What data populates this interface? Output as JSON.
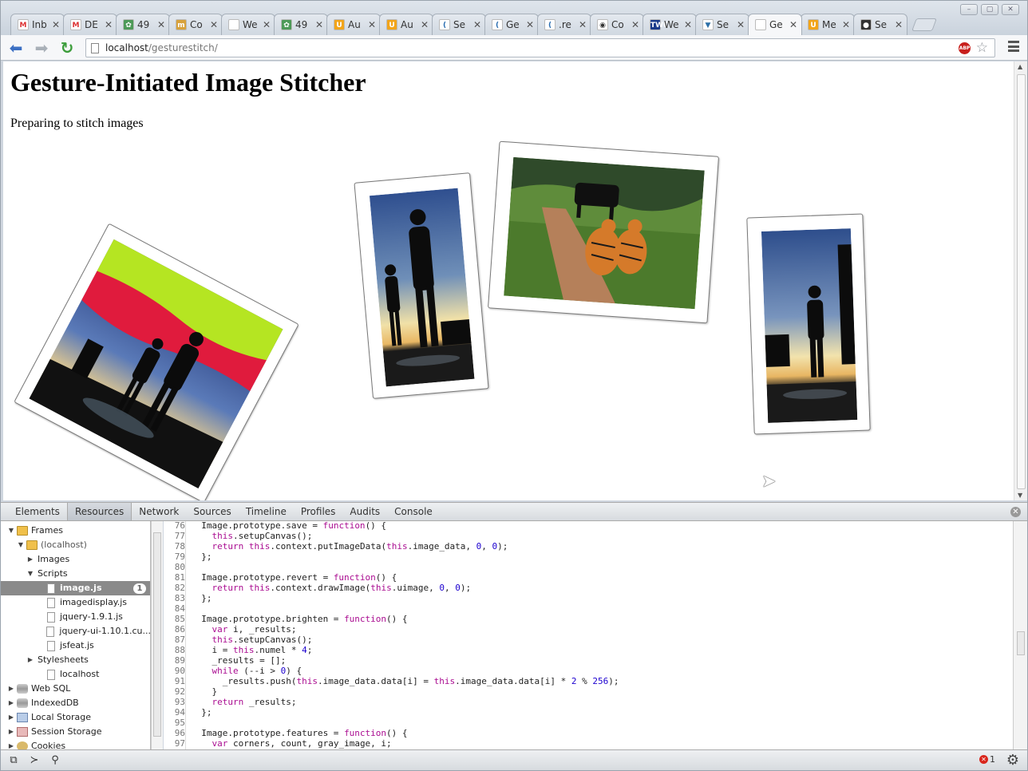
{
  "browser": {
    "tabs": [
      {
        "label": "Inb",
        "fav_color": "#fff",
        "fav_text": "M",
        "fav_fg": "#d33"
      },
      {
        "label": "DE",
        "fav_color": "#fff",
        "fav_text": "M",
        "fav_fg": "#d33"
      },
      {
        "label": "49",
        "fav_color": "#4d9a58",
        "fav_text": "✿",
        "fav_fg": "#fff"
      },
      {
        "label": "Co",
        "fav_color": "#d8a23b",
        "fav_text": "m",
        "fav_fg": "#fff"
      },
      {
        "label": "We",
        "fav_color": "#ffffff",
        "fav_text": "",
        "fav_fg": "#999"
      },
      {
        "label": "49",
        "fav_color": "#4d9a58",
        "fav_text": "✿",
        "fav_fg": "#fff"
      },
      {
        "label": "Au",
        "fav_color": "#f2a51a",
        "fav_text": "U",
        "fav_fg": "#fff"
      },
      {
        "label": "Au",
        "fav_color": "#f2a51a",
        "fav_text": "U",
        "fav_fg": "#fff"
      },
      {
        "label": "Se",
        "fav_color": "#ffffff",
        "fav_text": "(",
        "fav_fg": "#2a6db0"
      },
      {
        "label": "Ge",
        "fav_color": "#ffffff",
        "fav_text": "(",
        "fav_fg": "#2a6db0"
      },
      {
        "label": ".re",
        "fav_color": "#ffffff",
        "fav_text": "(",
        "fav_fg": "#2a6db0"
      },
      {
        "label": "Co",
        "fav_color": "#ffffff",
        "fav_text": "◉",
        "fav_fg": "#333"
      },
      {
        "label": "We",
        "fav_color": "#1a3b8a",
        "fav_text": "TWC",
        "fav_fg": "#fff"
      },
      {
        "label": "Se",
        "fav_color": "#ffffff",
        "fav_text": "▼",
        "fav_fg": "#2b6fa8"
      },
      {
        "label": "Ge",
        "fav_color": "#ffffff",
        "fav_text": "",
        "fav_fg": "#999",
        "active": true
      },
      {
        "label": "Me",
        "fav_color": "#f2a51a",
        "fav_text": "U",
        "fav_fg": "#fff"
      },
      {
        "label": "Se",
        "fav_color": "#333333",
        "fav_text": "●",
        "fav_fg": "#fff"
      }
    ],
    "url_host": "localhost",
    "url_path": "/gesturestitch/",
    "abp_label": "ABP"
  },
  "page": {
    "title": "Gesture-Initiated Image Stitcher",
    "status": "Preparing to stitch images"
  },
  "devtools": {
    "tabs": [
      "Elements",
      "Resources",
      "Network",
      "Sources",
      "Timeline",
      "Profiles",
      "Audits",
      "Console"
    ],
    "active_tab": "Resources",
    "tree": [
      {
        "label": "Frames",
        "indent": 0,
        "tri": "▼",
        "icon": "folder"
      },
      {
        "label": "(localhost)",
        "indent": 1,
        "tri": "▼",
        "icon": "folder",
        "muted": true
      },
      {
        "label": "Images",
        "indent": 2,
        "tri": "▶",
        "icon": "none"
      },
      {
        "label": "Scripts",
        "indent": 2,
        "tri": "▼",
        "icon": "none"
      },
      {
        "label": "image.js",
        "indent": 3,
        "tri": "",
        "icon": "file",
        "selected": true,
        "badge": "1"
      },
      {
        "label": "imagedisplay.js",
        "indent": 3,
        "tri": "",
        "icon": "file"
      },
      {
        "label": "jquery-1.9.1.js",
        "indent": 3,
        "tri": "",
        "icon": "file"
      },
      {
        "label": "jquery-ui-1.10.1.cu...",
        "indent": 3,
        "tri": "",
        "icon": "file"
      },
      {
        "label": "jsfeat.js",
        "indent": 3,
        "tri": "",
        "icon": "file"
      },
      {
        "label": "Stylesheets",
        "indent": 2,
        "tri": "▶",
        "icon": "none"
      },
      {
        "label": "localhost",
        "indent": 3,
        "tri": "",
        "icon": "file"
      },
      {
        "label": "Web SQL",
        "indent": 0,
        "tri": "▶",
        "icon": "db"
      },
      {
        "label": "IndexedDB",
        "indent": 0,
        "tri": "▶",
        "icon": "db"
      },
      {
        "label": "Local Storage",
        "indent": 0,
        "tri": "▶",
        "icon": "grid"
      },
      {
        "label": "Session Storage",
        "indent": 0,
        "tri": "▶",
        "icon": "gridred"
      },
      {
        "label": "Cookies",
        "indent": 0,
        "tri": "▶",
        "icon": "cookie"
      }
    ],
    "code": [
      {
        "n": "76",
        "t": "  Image.prototype.save = function() {"
      },
      {
        "n": "77",
        "t": "    this.setupCanvas();"
      },
      {
        "n": "78",
        "t": "    return this.context.putImageData(this.image_data, 0, 0);"
      },
      {
        "n": "79",
        "t": "  };"
      },
      {
        "n": "80",
        "t": ""
      },
      {
        "n": "81",
        "t": "  Image.prototype.revert = function() {"
      },
      {
        "n": "82",
        "t": "    return this.context.drawImage(this.uimage, 0, 0);"
      },
      {
        "n": "83",
        "t": "  };"
      },
      {
        "n": "84",
        "t": ""
      },
      {
        "n": "85",
        "t": "  Image.prototype.brighten = function() {"
      },
      {
        "n": "86",
        "t": "    var i, _results;"
      },
      {
        "n": "87",
        "t": "    this.setupCanvas();"
      },
      {
        "n": "88",
        "t": "    i = this.numel * 4;"
      },
      {
        "n": "89",
        "t": "    _results = [];"
      },
      {
        "n": "90",
        "t": "    while (--i > 0) {"
      },
      {
        "n": "91",
        "t": "      _results.push(this.image_data.data[i] = this.image_data.data[i] * 2 % 256);"
      },
      {
        "n": "92",
        "t": "    }"
      },
      {
        "n": "93",
        "t": "    return _results;"
      },
      {
        "n": "94",
        "t": "  };"
      },
      {
        "n": "95",
        "t": ""
      },
      {
        "n": "96",
        "t": "  Image.prototype.features = function() {"
      },
      {
        "n": "97",
        "t": "    var corners, count, gray_image, i;"
      }
    ],
    "error_count": "1"
  }
}
